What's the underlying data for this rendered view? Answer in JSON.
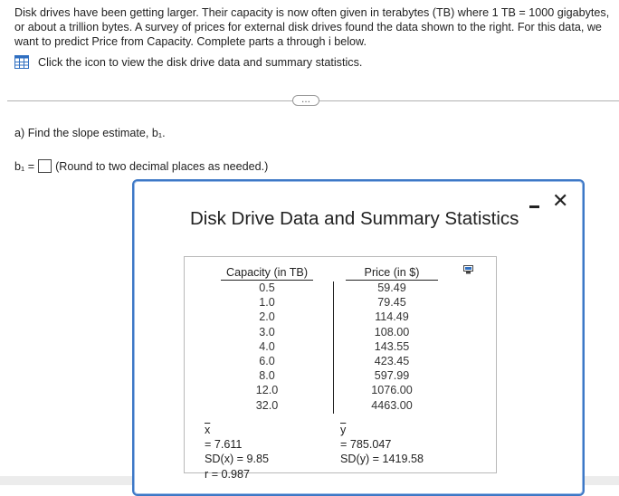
{
  "intro": "Disk drives have been getting larger. Their capacity is now often given in terabytes (TB) where 1 TB = 1000 gigabytes, or about a trillion bytes. A survey of prices for external disk drives found the data shown to the right. For this data, we want to predict Price from Capacity. Complete parts a through i below.",
  "data_link": "Click the icon to view the disk drive data and summary statistics.",
  "more_button": "…",
  "part_a": "a) Find the slope estimate, b₁.",
  "answer": {
    "label": "b₁ =",
    "hint": "(Round to two decimal places as needed.)"
  },
  "dialog": {
    "title": "Disk Drive Data and Summary Statistics",
    "close": "✕",
    "columns": [
      "Capacity (in TB)",
      "Price (in $)"
    ],
    "rows": [
      [
        "0.5",
        "59.49"
      ],
      [
        "1.0",
        "79.45"
      ],
      [
        "2.0",
        "114.49"
      ],
      [
        "3.0",
        "108.00"
      ],
      [
        "4.0",
        "143.55"
      ],
      [
        "6.0",
        "423.45"
      ],
      [
        "8.0",
        "597.99"
      ],
      [
        "12.0",
        "1076.00"
      ],
      [
        "32.0",
        "4463.00"
      ]
    ],
    "stats": {
      "xbar_symbol": "x",
      "xbar_value": " = 7.611",
      "sdx": "SD(x) = 9.85",
      "r": "r = 0.987",
      "ybar_symbol": "y",
      "ybar_value": " = 785.047",
      "sdy": "SD(y) = 1419.58"
    }
  },
  "colors": {
    "dialog_border": "#3d78c6",
    "icon_blue": "#2f6fc1"
  }
}
